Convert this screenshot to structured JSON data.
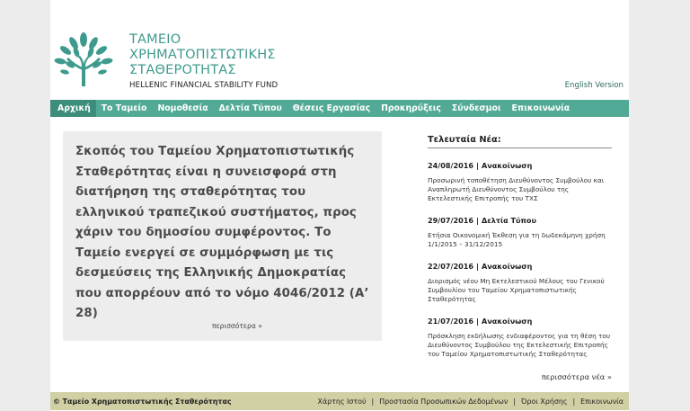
{
  "header": {
    "name_line1": "ΤΑΜΕΙΟ",
    "name_line2": "ΧΡΗΜΑΤΟΠΙΣΤΩΤΙΚΗΣ",
    "name_line3": "ΣΤΑΘΕΡΟΤΗΤΑΣ",
    "name_english": "HELLENIC FINANCIAL STABILITY FUND",
    "lang_link": "English Version",
    "brand_color": "#3f9a8e"
  },
  "nav": {
    "bar_color": "#52aa96",
    "items": [
      {
        "label": "Αρχική",
        "active": true
      },
      {
        "label": "Το Ταμείο"
      },
      {
        "label": "Νομοθεσία"
      },
      {
        "label": "Δελτία Τύπου"
      },
      {
        "label": "Θέσεις Εργασίας"
      },
      {
        "label": "Προκηρύξεις"
      },
      {
        "label": "Σύνδεσμοι"
      },
      {
        "label": "Επικοινωνία"
      }
    ]
  },
  "mission": {
    "text": "Σκοπός του Ταμείου Χρηματοπιστωτικής Σταθερότητας είναι η συνεισφορά στη διατήρηση της σταθερότητας του ελληνικού τραπεζικού συστήματος, προς χάριν του δημοσίου συμφέροντος. Το Ταμείο ενεργεί σε συμμόρφωση με τις δεσμεύσεις της Ελληνικής Δημοκρατίας που απορρέουν από το νόμο 4046/2012 (Α’ 28)",
    "more": "περισσότερα »"
  },
  "news": {
    "title": "Τελευταία Νέα:",
    "separator": "|",
    "items": [
      {
        "date": "24/08/2016",
        "category": "Ανακοίνωση",
        "text": "Προσωρινή τοποθέτηση Διευθύνοντος Συμβούλου και Αναπληρωτή Διευθύνοντος Συμβούλου της Εκτελεστικής Επιτροπής του ΤΧΣ"
      },
      {
        "date": "29/07/2016",
        "category": "Δελτία Τύπου",
        "text": "Ετήσια Οικονομική Έκθεση για τη δωδεκάμηνη χρήση 1/1/2015 – 31/12/2015"
      },
      {
        "date": "22/07/2016",
        "category": "Ανακοίνωση",
        "text": "Διορισμός νέου Μη Εκτελεστικού Μέλους του Γενικού Συμβουλίου του Ταμείου Χρηματοπιστωτικής Σταθερότητας"
      },
      {
        "date": "21/07/2016",
        "category": "Ανακοίνωση",
        "text": "Πρόσκληση εκδήλωσης ενδιαφέροντος για τη θέση του Διευθύνοντος Συμβούλου της Εκτελεστικής Επιτροπής του Ταμείου Χρηματοπιστωτικής Σταθερότητας"
      }
    ],
    "more": "περισσότερα νέα »"
  },
  "footer": {
    "copyright": "© Ταμείο Χρηματοπιστωτικής Σταθερότητας",
    "separator": "|",
    "links": [
      "Χάρτης Ιστού",
      "Προστασία Προσωπικών Δεδομένων",
      "Όροι Χρήσης",
      "Επικοινωνία"
    ],
    "bg_color": "#d1cfa4"
  }
}
